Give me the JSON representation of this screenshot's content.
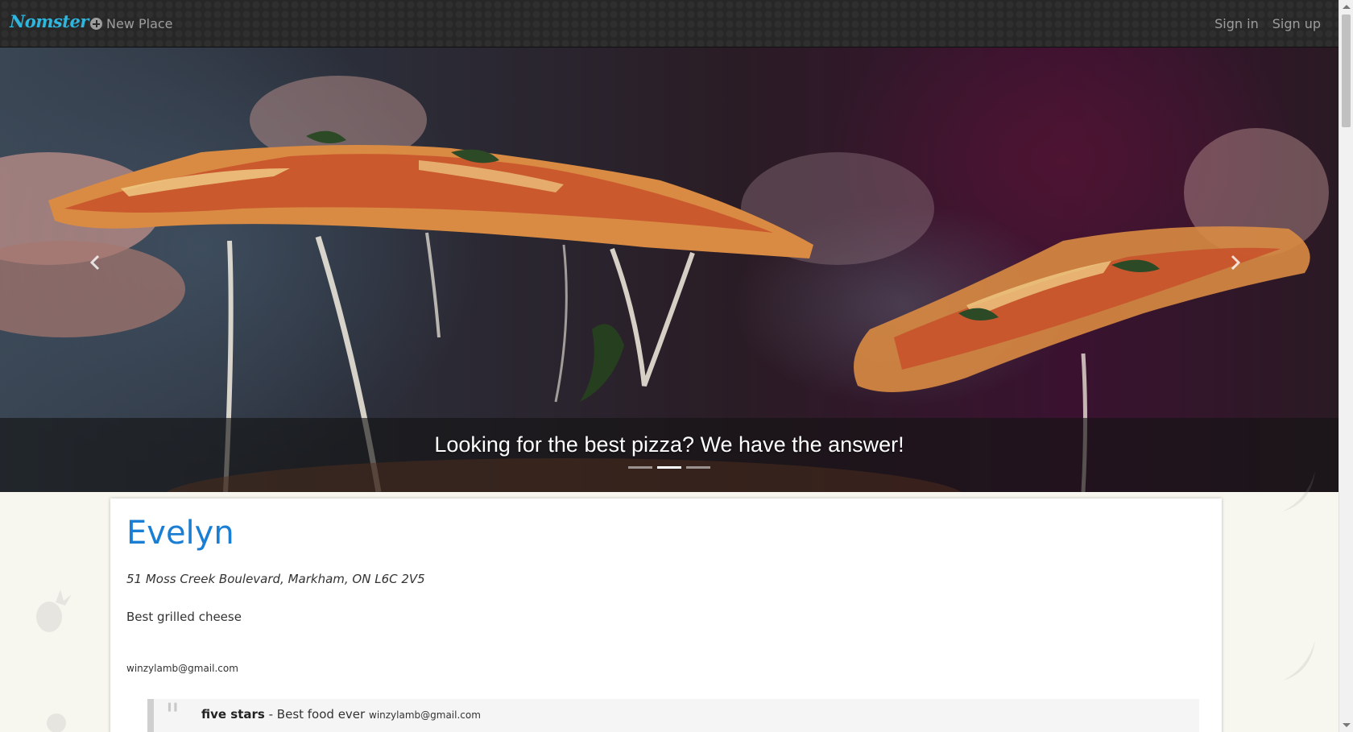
{
  "navbar": {
    "brand": "Nomster",
    "new_place_label": "New Place",
    "sign_in_label": "Sign in",
    "sign_up_label": "Sign up"
  },
  "carousel": {
    "caption": "Looking for the best pizza? We have the answer!",
    "slide_count": 3,
    "active_slide": 2
  },
  "place": {
    "name": "Evelyn",
    "address": "51 Moss Creek Boulevard, Markham, ON L6C 2V5",
    "description": "Best grilled cheese",
    "owner_email": "winzylamb@gmail.com"
  },
  "comments": [
    {
      "rating": "five stars",
      "separator": " - ",
      "message": "Best food ever",
      "author": "winzylamb@gmail.com"
    }
  ],
  "colors": {
    "navbar_bg": "#272727",
    "brand": "#2fb6de",
    "place_name": "#1a7fd4",
    "page_bg": "#f8f7ef"
  }
}
